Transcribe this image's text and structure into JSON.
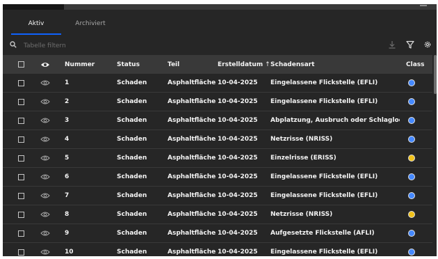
{
  "tabs": [
    {
      "label": "Aktiv",
      "active": true
    },
    {
      "label": "Archiviert",
      "active": false
    }
  ],
  "search": {
    "placeholder": "Tabelle filtern",
    "value": ""
  },
  "toolbar_icons": [
    "search-icon",
    "download-icon",
    "filter-icon",
    "gear-icon"
  ],
  "columns": {
    "visibility_icon": "eye-icon",
    "nummer": "Nummer",
    "status": "Status",
    "teil": "Teil",
    "erstelldatum": "Erstelldatum",
    "sort_indicator": "↑",
    "schadensart": "Schadensart",
    "class": "Class"
  },
  "class_colors": {
    "blue": "#4589ff",
    "yellow": "#f1c21b"
  },
  "rows": [
    {
      "nummer": "1",
      "status": "Schaden",
      "teil": "Asphaltfläche",
      "erstelldatum": "10-04-2025",
      "schadensart": "Eingelassene Flickstelle (EFLI)",
      "class_color": "#4589ff"
    },
    {
      "nummer": "2",
      "status": "Schaden",
      "teil": "Asphaltfläche",
      "erstelldatum": "10-04-2025",
      "schadensart": "Eingelassene Flickstelle (EFLI)",
      "class_color": "#4589ff"
    },
    {
      "nummer": "3",
      "status": "Schaden",
      "teil": "Asphaltfläche",
      "erstelldatum": "10-04-2025",
      "schadensart": "Abplatzung, Ausbruch oder Schlagloch (A",
      "class_color": "#4589ff"
    },
    {
      "nummer": "4",
      "status": "Schaden",
      "teil": "Asphaltfläche",
      "erstelldatum": "10-04-2025",
      "schadensart": "Netzrisse (NRISS)",
      "class_color": "#4589ff"
    },
    {
      "nummer": "5",
      "status": "Schaden",
      "teil": "Asphaltfläche",
      "erstelldatum": "10-04-2025",
      "schadensart": "Einzelrisse (ERISS)",
      "class_color": "#f1c21b"
    },
    {
      "nummer": "6",
      "status": "Schaden",
      "teil": "Asphaltfläche",
      "erstelldatum": "10-04-2025",
      "schadensart": "Eingelassene Flickstelle (EFLI)",
      "class_color": "#4589ff"
    },
    {
      "nummer": "7",
      "status": "Schaden",
      "teil": "Asphaltfläche",
      "erstelldatum": "10-04-2025",
      "schadensart": "Eingelassene Flickstelle (EFLI)",
      "class_color": "#4589ff"
    },
    {
      "nummer": "8",
      "status": "Schaden",
      "teil": "Asphaltfläche",
      "erstelldatum": "10-04-2025",
      "schadensart": "Netzrisse (NRISS)",
      "class_color": "#f1c21b"
    },
    {
      "nummer": "9",
      "status": "Schaden",
      "teil": "Asphaltfläche",
      "erstelldatum": "10-04-2025",
      "schadensart": "Aufgesetzte Flickstelle (AFLI)",
      "class_color": "#4589ff"
    },
    {
      "nummer": "10",
      "status": "Schaden",
      "teil": "Asphaltfläche",
      "erstelldatum": "10-04-2025",
      "schadensart": "Eingelassene Flickstelle (EFLI)",
      "class_color": "#4589ff"
    }
  ]
}
